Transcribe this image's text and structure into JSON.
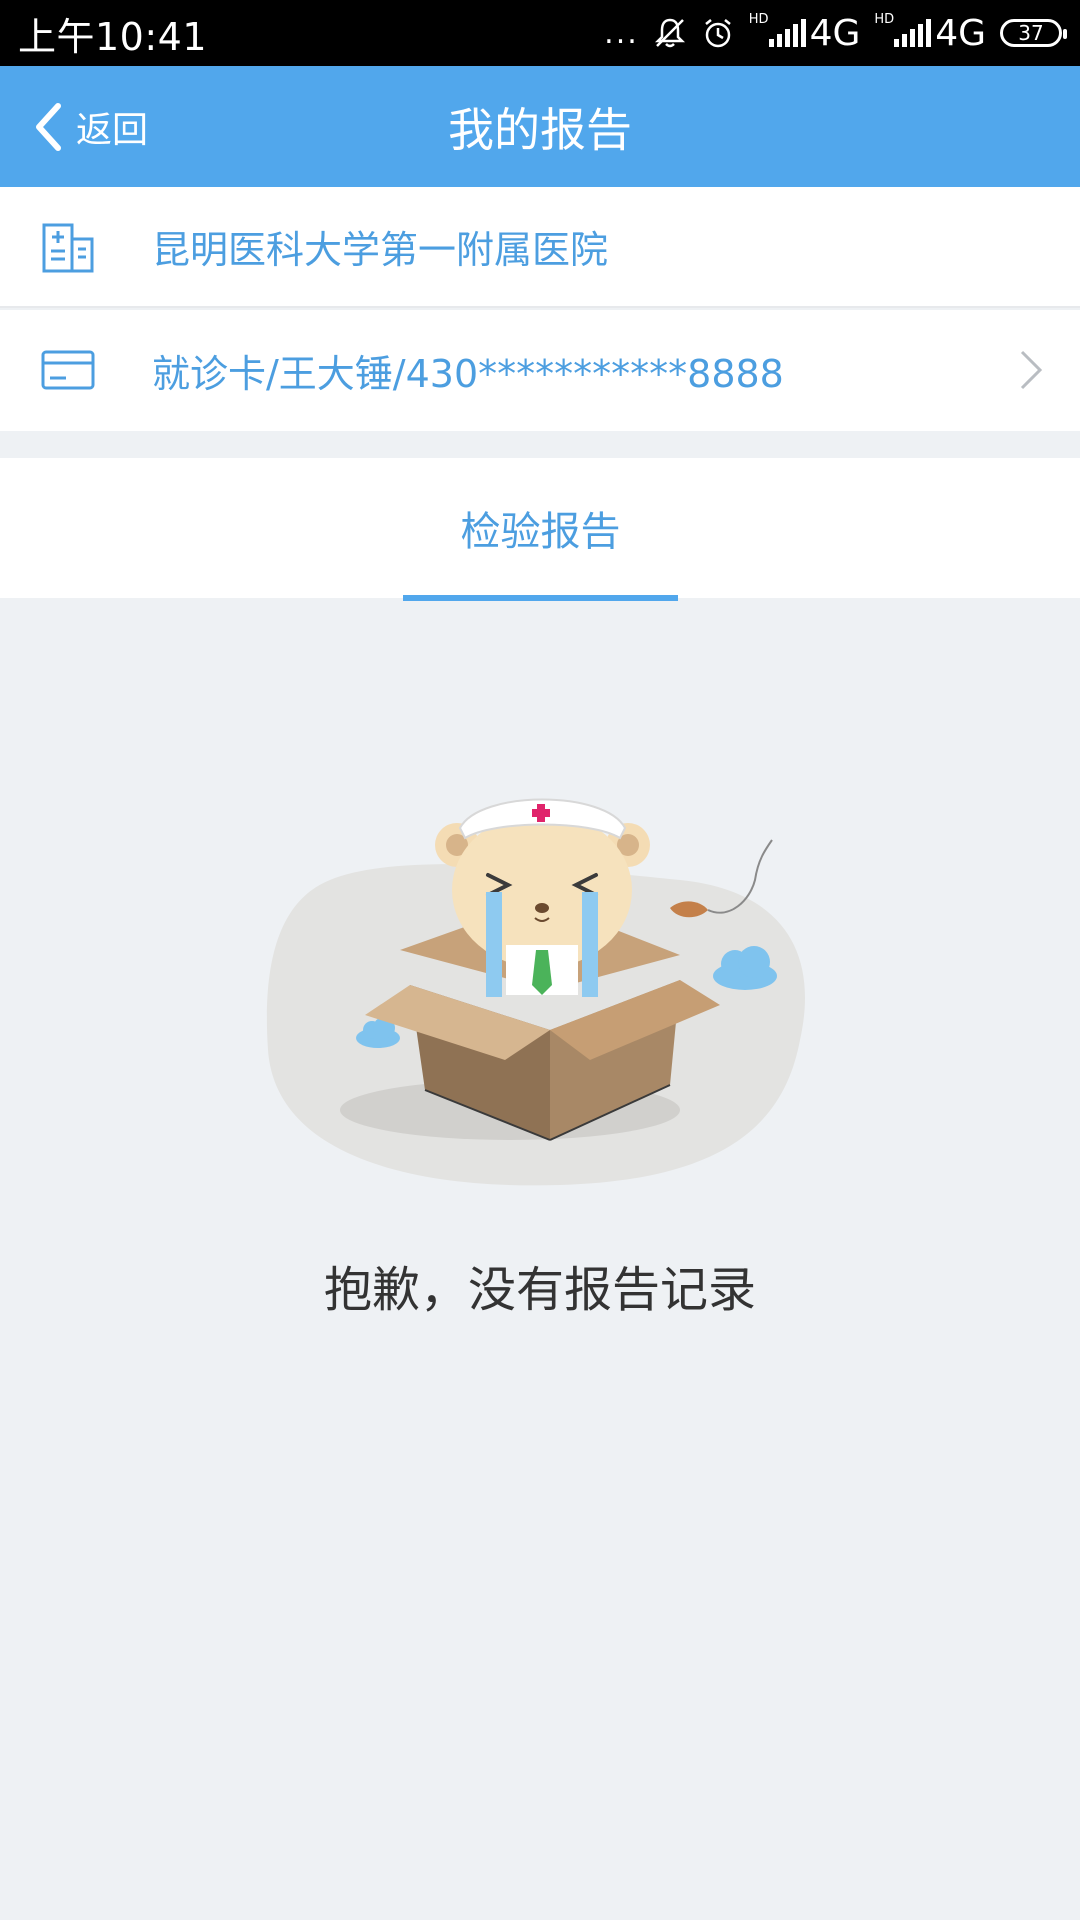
{
  "status_bar": {
    "time": "上午10:41",
    "dots": "...",
    "network_1": "4G",
    "network_2": "4G",
    "hd_1": "HD",
    "hd_2": "HD",
    "battery": "37"
  },
  "nav": {
    "back_label": "返回",
    "title": "我的报告"
  },
  "hospital": {
    "name": "昆明医科大学第一附属医院",
    "icon": "hospital-building-icon"
  },
  "card": {
    "text": "就诊卡/王大锤/430***********8888",
    "icon": "card-icon"
  },
  "tabs": [
    {
      "label": "检验报告",
      "active": true
    }
  ],
  "empty_state": {
    "message": "抱歉，没有报告记录",
    "illustration": "crying-bear-nurse-in-box"
  },
  "colors": {
    "primary": "#51a7ec",
    "text_accent": "#4c9ee0",
    "background": "#eef1f4"
  }
}
